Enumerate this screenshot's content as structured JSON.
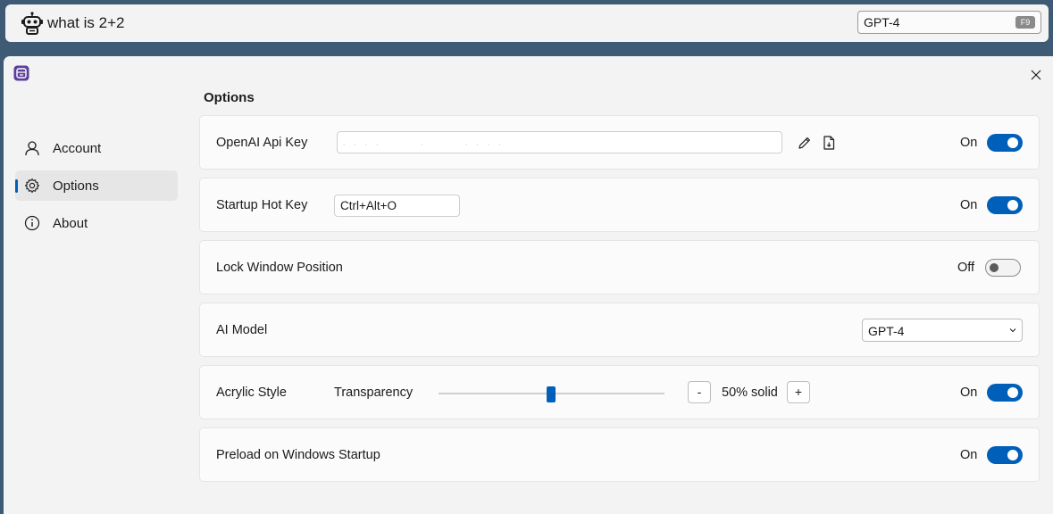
{
  "query_bar": {
    "query": "what is 2+2",
    "model": "GPT-4",
    "hotkey_badge": "F9"
  },
  "window": {
    "close_label": "✕"
  },
  "nav": {
    "items": [
      {
        "label": "Account",
        "icon": "person-icon",
        "selected": false
      },
      {
        "label": "Options",
        "icon": "gear-icon",
        "selected": true
      },
      {
        "label": "About",
        "icon": "info-icon",
        "selected": false
      }
    ]
  },
  "options": {
    "title": "Options",
    "api_key": {
      "label": "OpenAI Api Key",
      "value": ", , , ,       ,       , , , ,",
      "state": "On",
      "enabled": true
    },
    "hotkey": {
      "label": "Startup Hot Key",
      "value": "Ctrl+Alt+O",
      "state": "On",
      "enabled": true
    },
    "lock_window": {
      "label": "Lock Window Position",
      "state": "Off",
      "enabled": false
    },
    "ai_model": {
      "label": "AI Model",
      "value": "GPT-4"
    },
    "acrylic": {
      "label": "Acrylic Style",
      "transparency_label": "Transparency",
      "transparency_fraction": 0.5,
      "minus": "-",
      "plus": "+",
      "percent_label": "50% solid",
      "state": "On",
      "enabled": true
    },
    "preload": {
      "label": "Preload on Windows Startup",
      "state": "On",
      "enabled": true
    }
  },
  "colors": {
    "accent": "#005fb8",
    "background": "#3f5a75",
    "surface": "#f3f3f3",
    "card": "#fbfbfb"
  }
}
